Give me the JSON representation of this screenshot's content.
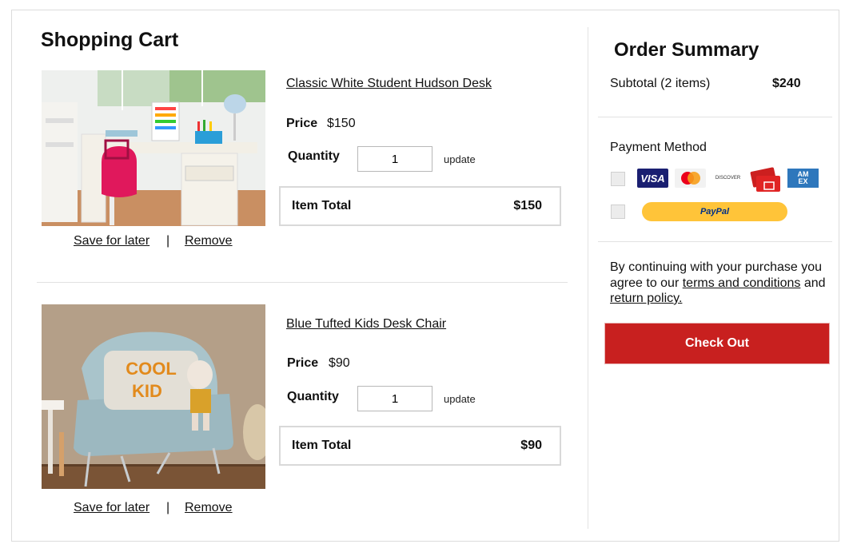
{
  "cart": {
    "title": "Shopping Cart",
    "items": [
      {
        "name": "Classic White Student Hudson Desk",
        "price_label": "Price",
        "price": "$150",
        "quantity_label": "Quantity",
        "quantity": "1",
        "update_label": "update",
        "total_label": "Item Total",
        "total": "$150",
        "save_label": "Save for later",
        "separator": "|",
        "remove_label": "Remove"
      },
      {
        "name": "Blue Tufted Kids Desk Chair",
        "price_label": "Price",
        "price": "$90",
        "quantity_label": "Quantity",
        "quantity": "1",
        "update_label": "update",
        "total_label": "Item Total",
        "total": "$90",
        "save_label": "Save for later",
        "separator": "|",
        "remove_label": "Remove"
      }
    ]
  },
  "summary": {
    "title": "Order Summary",
    "subtotal_label": "Subtotal (2 items)",
    "subtotal_value": "$240",
    "payment_label": "Payment Method",
    "cards": [
      {
        "name": "visa-icon",
        "text": "VISA"
      },
      {
        "name": "mastercard-icon",
        "text": ""
      },
      {
        "name": "discover-icon",
        "text": "DISCOVER"
      },
      {
        "name": "credit-card-icon",
        "text": ""
      },
      {
        "name": "amex-icon",
        "text": "AM EX"
      }
    ],
    "paypal_text": "PayPal",
    "terms_prefix": "By continuing with your purchase you agree to our ",
    "terms_link": "terms and conditions",
    "terms_middle": " and ",
    "return_link": "return policy.",
    "checkout_label": "Check Out"
  },
  "colors": {
    "checkout": "#c8201f",
    "paypal": "#ffc439",
    "visa": "#1a1f71",
    "amex": "#2e77bc"
  }
}
